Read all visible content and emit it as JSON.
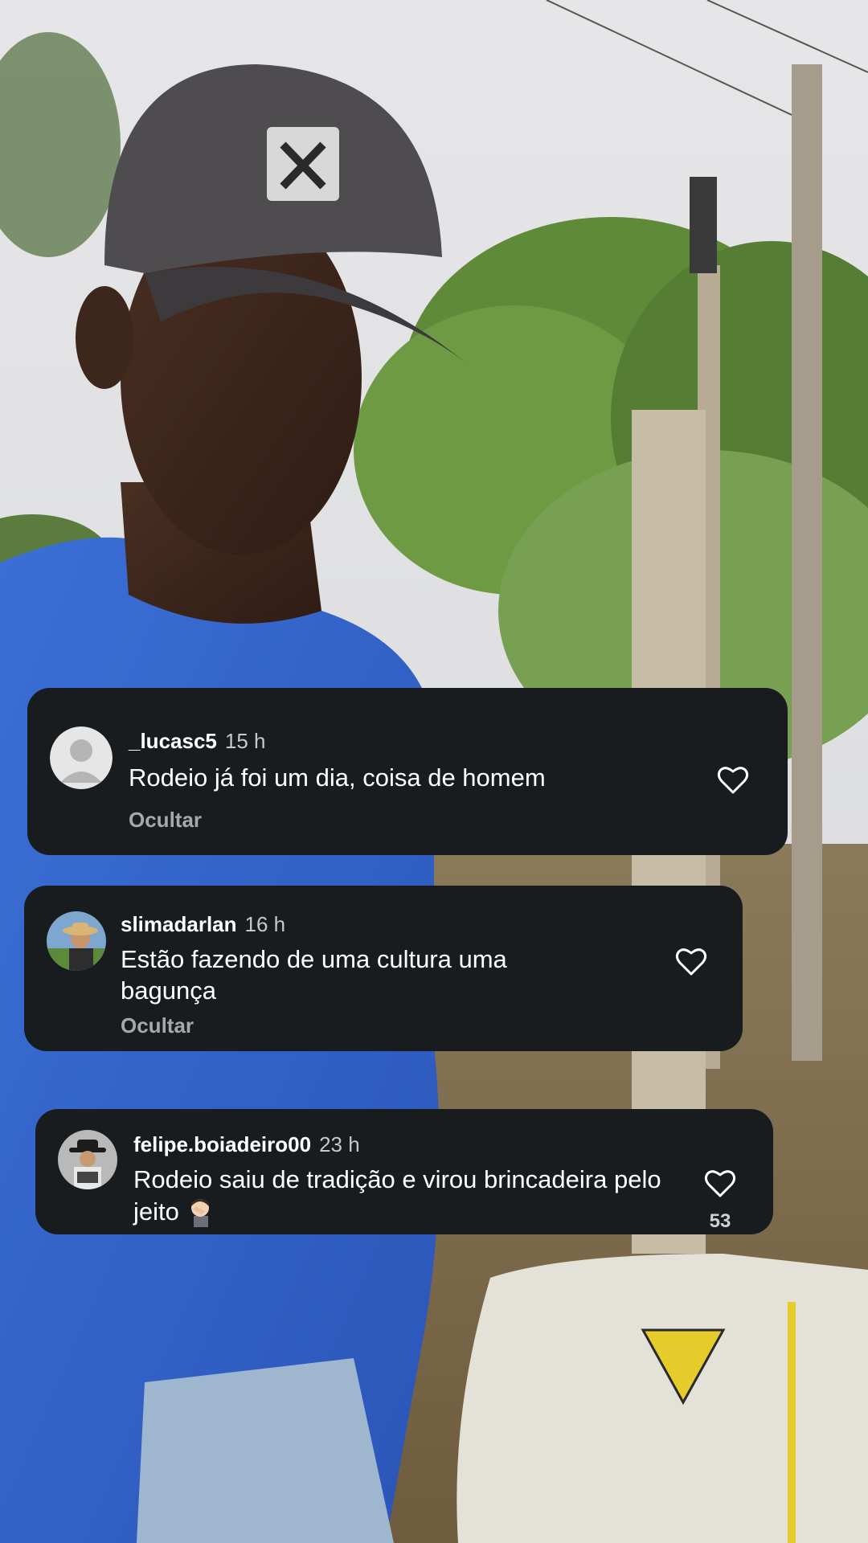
{
  "comments": [
    {
      "username": "_lucasc5",
      "time": "15 h",
      "text": "Rodeio já foi um dia, coisa de homem",
      "hide_label": "Ocultar",
      "avatar_icon": "default-profile-avatar"
    },
    {
      "username": "slimadarlan",
      "time": "16 h",
      "text": "Estão fazendo de uma cultura uma bagunça",
      "hide_label": "Ocultar",
      "avatar_icon": "profile-photo-hat"
    },
    {
      "username": "felipe.boiadeiro00",
      "time": "23 h",
      "text": "Rodeio saiu de tradição e virou brincadeira pelo jeito",
      "emoji": "facepalm-emoji",
      "like_count": "53",
      "avatar_icon": "profile-photo-cowboy"
    }
  ],
  "colors": {
    "card_background": "#181c1f",
    "text_primary": "#ffffff",
    "text_secondary": "#a8a8a8"
  }
}
